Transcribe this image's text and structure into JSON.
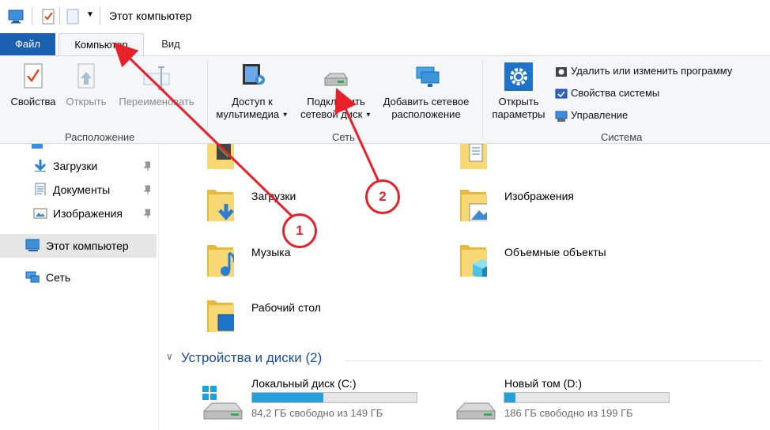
{
  "window": {
    "title": "Этот компьютер"
  },
  "tabs": {
    "file": "Файл",
    "computer": "Компьютер",
    "view": "Вид"
  },
  "ribbon": {
    "location": {
      "group_label": "Расположение",
      "properties": "Свойства",
      "open": "Открыть",
      "rename": "Переименовать"
    },
    "network": {
      "group_label": "Сеть",
      "media_access_l1": "Доступ к",
      "media_access_l2": "мультимедиа",
      "map_drive_l1": "Подключить",
      "map_drive_l2": "сетевой диск",
      "add_location_l1": "Добавить сетевое",
      "add_location_l2": "расположение"
    },
    "system": {
      "group_label": "Система",
      "open_settings_l1": "Открыть",
      "open_settings_l2": "параметры",
      "uninstall": "Удалить или изменить программу",
      "system_properties": "Свойства системы",
      "manage": "Управление"
    }
  },
  "nav": {
    "items": [
      {
        "label": "Загрузки",
        "icon": "download-arrow-icon"
      },
      {
        "label": "Документы",
        "icon": "document-icon"
      },
      {
        "label": "Изображения",
        "icon": "image-icon"
      },
      {
        "label": "Этот компьютер",
        "icon": "computer-icon"
      },
      {
        "label": "Сеть",
        "icon": "network-icon"
      }
    ]
  },
  "folders": [
    {
      "label": "Загрузки"
    },
    {
      "label": "Изображения"
    },
    {
      "label": "Музыка"
    },
    {
      "label": "Объемные объекты"
    },
    {
      "label": "Рабочий стол"
    }
  ],
  "devices": {
    "title": "Устройства и диски (2)",
    "drives": [
      {
        "name": "Локальный диск (C:)",
        "free_text": "84,2 ГБ свободно из 149 ГБ",
        "used_fraction": 0.435
      },
      {
        "name": "Новый том (D:)",
        "free_text": "186 ГБ свободно из 199 ГБ",
        "used_fraction": 0.065
      }
    ]
  },
  "annotations": {
    "marker1": "1",
    "marker2": "2"
  },
  "colors": {
    "accent": "#1a5fb0",
    "annotation": "#e8202a",
    "drive_fill": "#26a0da",
    "folder": "#f8d775"
  }
}
